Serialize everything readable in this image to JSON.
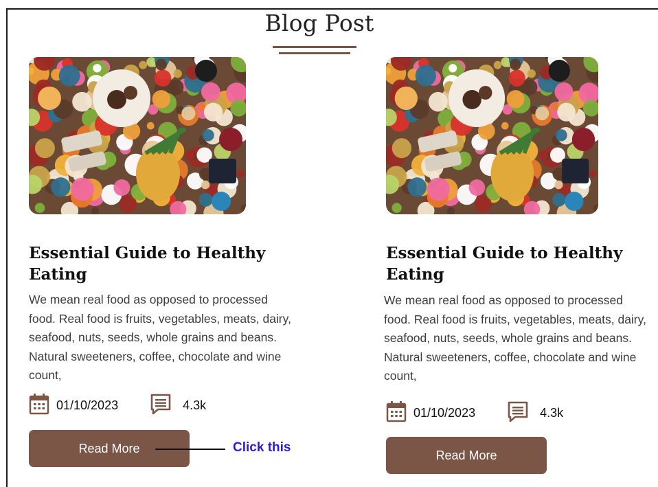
{
  "page": {
    "title": "Blog Post"
  },
  "cards": [
    {
      "title": "Essential Guide to Healthy Eating",
      "excerpt": "We mean real food as opposed to processed food. Real food is fruits, vegetables, meats, dairy, seafood, nuts, seeds, whole grains and beans. Natural sweeteners, coffee, chocolate and wine count,",
      "date": "01/10/2023",
      "comments": "4.3k",
      "button_label": "Read More",
      "image_icon": "food-flatlay-image"
    },
    {
      "title": "Essential Guide to Healthy Eating",
      "excerpt": "We mean real food as opposed to processed food. Real food is fruits, vegetables, meats, dairy, seafood, nuts, seeds, whole grains and beans. Natural sweeteners, coffee, chocolate and wine count,",
      "date": "01/10/2023",
      "comments": "4.3k",
      "button_label": "Read More",
      "image_icon": "food-flatlay-image"
    }
  ],
  "annotation": {
    "text": "Click this",
    "color": "#2a1bdc"
  },
  "icons": {
    "date": "calendar-icon",
    "comments": "comment-icon"
  },
  "colors": {
    "accent": "#7b5546",
    "title_line": "#7a5545"
  }
}
